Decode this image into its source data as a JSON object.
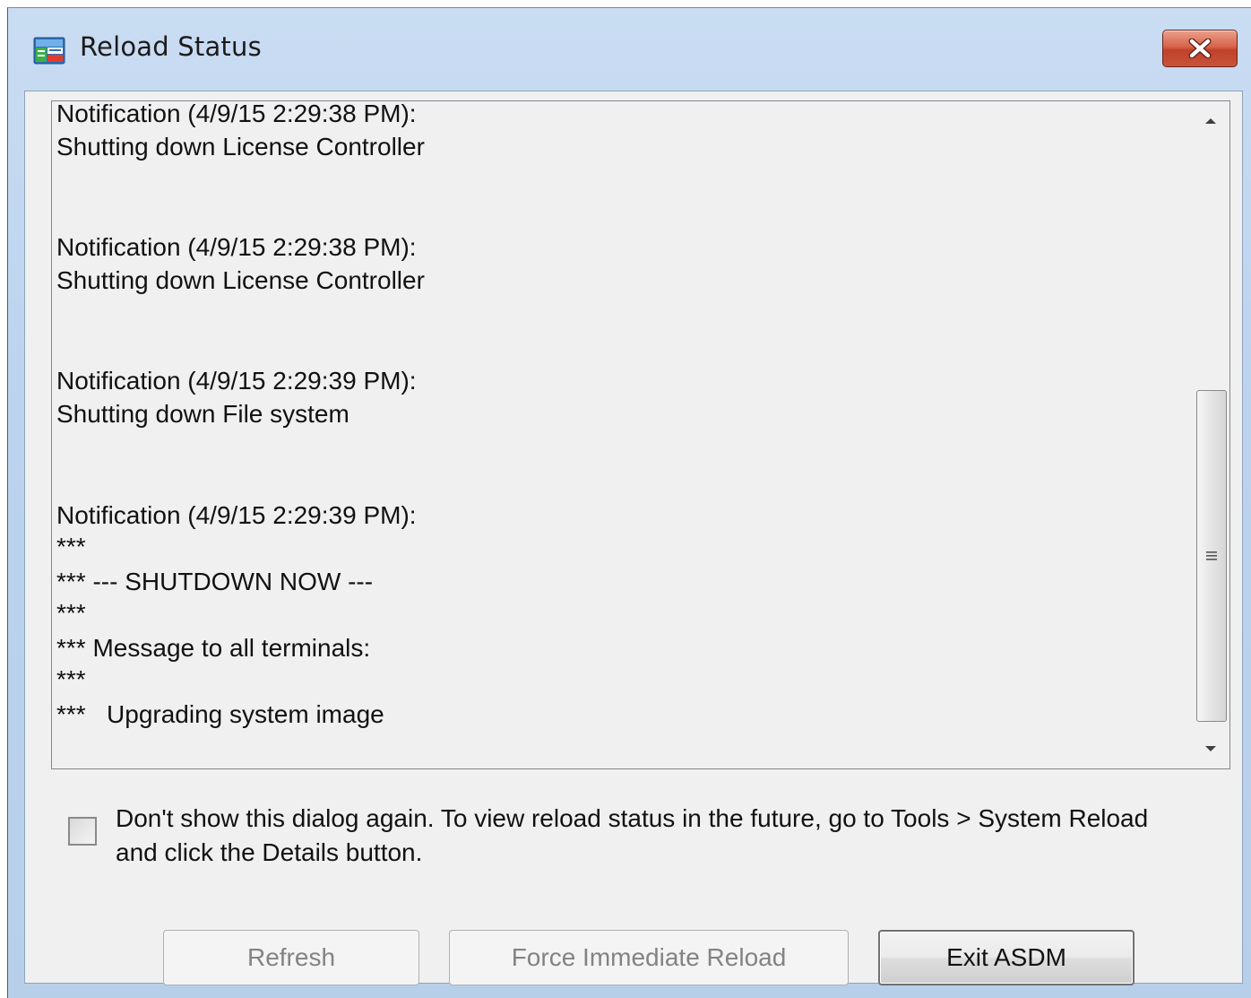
{
  "window": {
    "title": "Reload Status"
  },
  "log": {
    "lines": [
      "Notification (4/9/15 2:29:38 PM):",
      "Shutting down License Controller",
      "Notification (4/9/15 2:29:38 PM):",
      "Shutting down License Controller",
      "Notification (4/9/15 2:29:39 PM):",
      "Shutting down File system",
      "Notification (4/9/15 2:29:39 PM):",
      "***",
      "*** --- SHUTDOWN NOW ---",
      "***",
      "*** Message to all terminals:",
      "***",
      "***   Upgrading system image"
    ]
  },
  "checkbox": {
    "label": "Don't show this dialog again. To view reload status in the future, go to Tools > System Reload and click the Details button.",
    "checked": false
  },
  "buttons": {
    "refresh": "Refresh",
    "force_reload": "Force Immediate Reload",
    "exit": "Exit ASDM"
  },
  "icons": {
    "app": "asdm-app-icon",
    "close": "close-icon",
    "scroll_up": "scroll-up-arrow-icon",
    "scroll_down": "scroll-down-arrow-icon",
    "thumb_grip": "scroll-thumb-grip-icon"
  },
  "colors": {
    "close_button": "#c7533b",
    "titlebar": "#c9dcf2",
    "dialog_bg": "#f0f0f0"
  }
}
